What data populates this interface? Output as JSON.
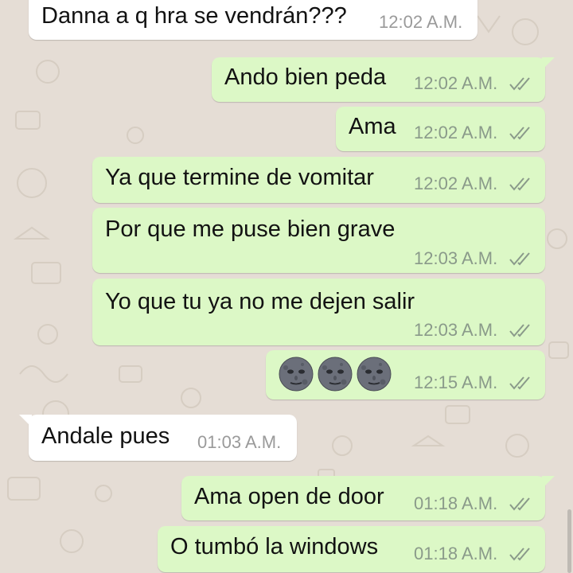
{
  "colors": {
    "incoming_bubble": "#ffffff",
    "outgoing_bubble": "#dcf8c6",
    "wallpaper": "#e5ddd5",
    "ticks": "#8a9a8a"
  },
  "messages": [
    {
      "direction": "incoming",
      "text": "Danna a q hra se vendrán???",
      "time": "12:02 A.M."
    },
    {
      "direction": "outgoing",
      "text": "Ando bien peda",
      "time": "12:02 A.M.",
      "status": "read-ticks-icon"
    },
    {
      "direction": "outgoing",
      "text": "Ama",
      "time": "12:02 A.M.",
      "status": "read-ticks-icon"
    },
    {
      "direction": "outgoing",
      "text": "Ya que termine de vomitar",
      "time": "12:02 A.M.",
      "status": "read-ticks-icon"
    },
    {
      "direction": "outgoing",
      "text": "Por que me puse bien grave",
      "time": "12:03 A.M.",
      "status": "read-ticks-icon"
    },
    {
      "direction": "outgoing",
      "text": "Yo que tu ya no me dejen salir",
      "time": "12:03 A.M.",
      "status": "read-ticks-icon"
    },
    {
      "direction": "outgoing",
      "emoji": [
        "new-moon-face-icon",
        "new-moon-face-icon",
        "new-moon-face-icon"
      ],
      "time": "12:15 A.M.",
      "status": "read-ticks-icon"
    },
    {
      "direction": "incoming",
      "text": "Andale pues",
      "time": "01:03 A.M."
    },
    {
      "direction": "outgoing",
      "text": "Ama open de door",
      "time": "01:18 A.M.",
      "status": "read-ticks-icon"
    },
    {
      "direction": "outgoing",
      "text": "O tumbó la windows",
      "time": "01:18 A.M.",
      "status": "read-ticks-icon"
    }
  ]
}
